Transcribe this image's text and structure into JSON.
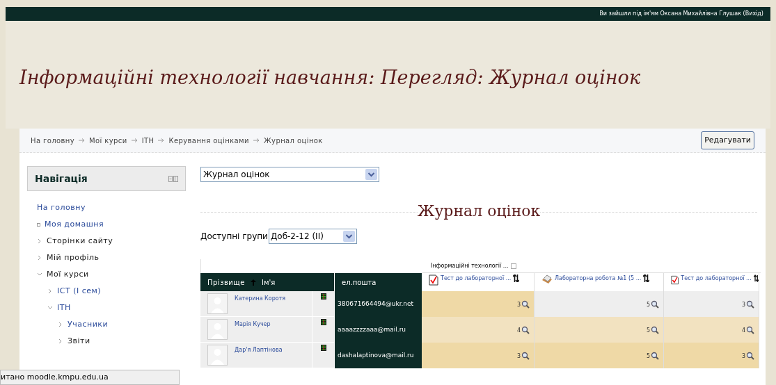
{
  "top_bar": {
    "login_text": "Ви зайшли під ім'ям Оксана Михайлівна Глушак (Вихід)"
  },
  "header": {
    "title": "Інформаційні технології навчання: Перегляд: Журнал оцінок"
  },
  "breadcrumb": [
    "На головну",
    "Мої курси",
    "ITH",
    "Керування оцінками",
    "Журнал оцінок"
  ],
  "edit_button": "Редагувати",
  "navigation": {
    "title": "Навігація",
    "items": [
      {
        "label": "На головну",
        "kind": "plain",
        "link": true
      },
      {
        "label": "Моя домашня",
        "kind": "bullet",
        "link": true
      },
      {
        "label": "Сторінки сайту",
        "kind": "branch",
        "link": false,
        "expanded": false
      },
      {
        "label": "Мій профіль",
        "kind": "branch",
        "link": false,
        "expanded": false
      },
      {
        "label": "Мої курси",
        "kind": "branch",
        "link": false,
        "expanded": true,
        "children": [
          {
            "label": "ICT (I сем)",
            "kind": "branch",
            "link": true,
            "expanded": false
          },
          {
            "label": "ITH",
            "kind": "branch",
            "link": true,
            "expanded": true,
            "children": [
              {
                "label": "Учасники",
                "kind": "branch",
                "link": true,
                "expanded": false
              },
              {
                "label": "Звіти",
                "kind": "branch",
                "link": false,
                "expanded": false
              }
            ]
          }
        ]
      }
    ]
  },
  "report_select": {
    "value": "Журнал оцінок"
  },
  "page_title": "Журнал оцінок",
  "group_filter": {
    "label": "Доступні групи",
    "value": "Доб-2-12 (II)"
  },
  "grade_table": {
    "category": "Інформаційні технології ...",
    "name_header": {
      "surname": "Прізвище",
      "first_name": "Ім'я"
    },
    "email_header": "ел.пошта",
    "columns": [
      {
        "label": "Тест до лабораторної ...",
        "kind": "quiz"
      },
      {
        "label": "Лабораторна робота №1 (5 ...",
        "kind": "assignment"
      },
      {
        "label": "Тест до лабораторної ...",
        "kind": "quiz"
      }
    ],
    "rows": [
      {
        "name": "Катерина Коротя",
        "email": "380671664494@ukr.net",
        "grades": [
          {
            "value": "3",
            "highlighted": true
          },
          {
            "value": "5",
            "highlighted": false
          },
          {
            "value": "3",
            "highlighted": false
          }
        ]
      },
      {
        "name": "Марія Кучер",
        "email": "aaaazzzzaaa@mail.ru",
        "grades": [
          {
            "value": "4",
            "highlighted": false
          },
          {
            "value": "5",
            "highlighted": false
          },
          {
            "value": "4",
            "highlighted": false
          }
        ]
      },
      {
        "name": "Дар'я Лаптінова",
        "email": "dashalaptinova@mail.ru",
        "grades": [
          {
            "value": "3",
            "highlighted": true
          },
          {
            "value": "5",
            "highlighted": true
          },
          {
            "value": "3",
            "highlighted": true
          }
        ]
      }
    ]
  },
  "status_bar": {
    "text": "итано moodle.kmpu.edu.ua"
  }
}
